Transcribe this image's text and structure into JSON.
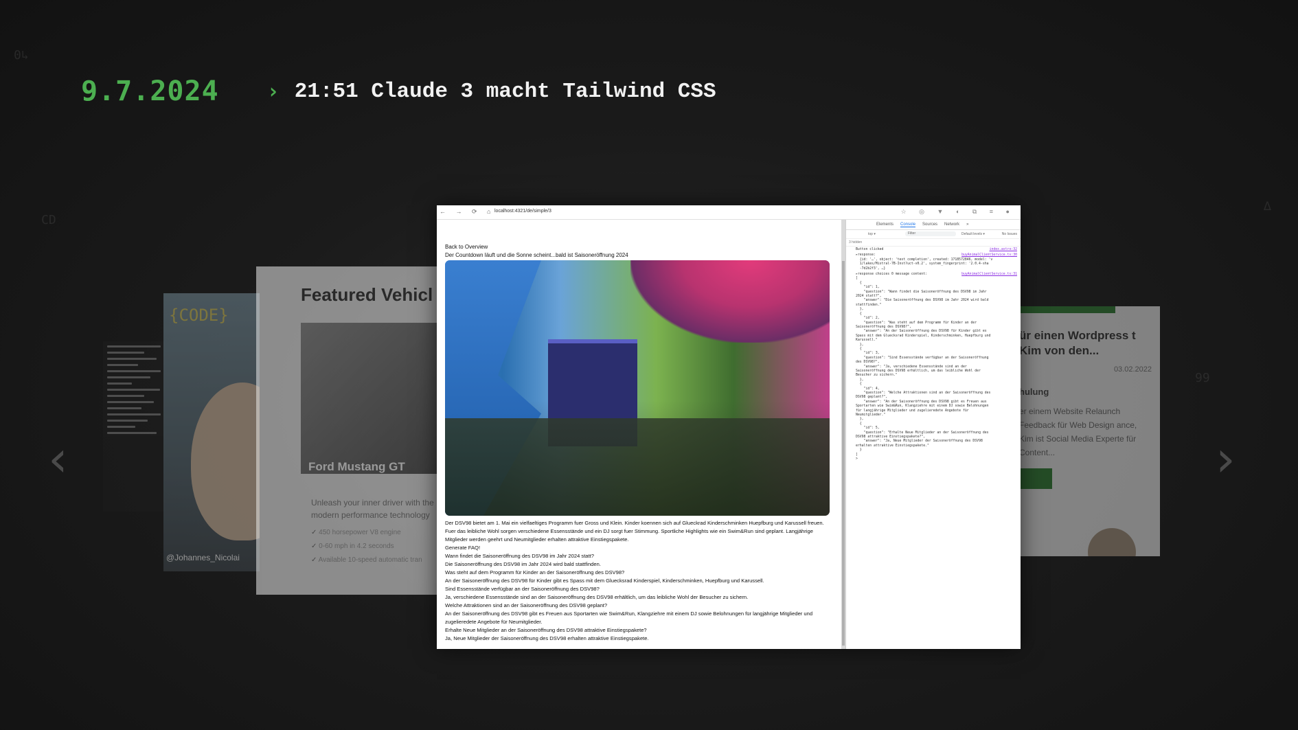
{
  "header": {
    "date": "9.7.2024",
    "chevron": "›",
    "title": "21:51 Claude 3 macht Tailwind CSS"
  },
  "carousel": {
    "prev_arrow": "‹",
    "next_arrow": "›",
    "portrait_card": {
      "logo": "{CODE}",
      "handle": "@Johannes_Nicolai"
    },
    "vehicle_card": {
      "title": "Featured Vehicl",
      "car_name": "Ford Mustang GT",
      "description": "Unleash your inner driver with the modern performance technology",
      "features": [
        "450 horsepower V8 engine",
        "0-60 mph in 4.2 seconds",
        "Available 10-speed automatic tran"
      ]
    },
    "blog_card": {
      "title": "ür einen Wordpress t Kim von den...",
      "date": "03.02.2022",
      "subtitle": "hulung",
      "text": "er einem Website Relaunch Feedback für Web Design ance, Kim ist Social Media Experte für Content..."
    }
  },
  "screenshot": {
    "browser": {
      "nav_icons": "← → ⟳ ⌂",
      "url": "localhost:4321/de/simple/3",
      "extension_icons": "☆ ◎ ▼ ◐ ⧉ ≡ ●"
    },
    "page": {
      "back_link": "Back to Overview",
      "heading": "Der Countdown läuft und die Sonne scheint...bald ist Saisoneröffnung 2024",
      "paragraphs": [
        "Der DSV98 bietet am 1. Mai ein vielfaeltiges Programm fuer Gross und Klein. Kinder koennen sich auf Glueckrad Kinderschminken Huepfburg und Karussell freuen. Fuer das leibliche Wohl sorgen verschiedene Essensstände und ein DJ sorgt fuer Stimmung. Sportliche Highlights wie ein Swim&Run sind geplant. Langjährige Mitglieder werden geehrt und Neumitglieder erhalten attraktive Einstiegspakete.",
        "Generate FAQ!",
        "Wann findet die Saisoneröffnung des DSV98 im Jahr 2024 statt?",
        "Die Saisoneröffnung des DSV98 im Jahr 2024 wird bald stattfinden.",
        "Was steht auf dem Programm für Kinder an der Saisoneröffnung des DSV98?",
        "An der Saisoneröffnung des DSV98 für Kinder gibt es Spass mit dem Gluecksrad Kinderspiel, Kinderschminken, Huepfburg und Karussell.",
        "Sind Essensstände verfügbar an der Saisoneröffnung des DSV98?",
        "Ja, verschiedene Essensstände sind an der Saisoneröffnung des DSV98 erhältlich, um das leibliche Wohl der Besucher zu sichern.",
        "Welche Attraktionen sind an der Saisoneröffnung des DSV98 geplant?",
        "An der Saisoneröffnung des DSV98 gibt es Freuen aus Sportarten wie Swim&Run, Klangziehre mit einem DJ sowie Belohnungen für langjährige Mitglieder und zugelieredete Angebote für Neumitglieder.",
        "Erhalte Neue Mitglieder an der Saisoneröffnung des DSV98 attraktive Einstiegspakete?",
        "Ja, Neue Mitglieder der Saisoneröffnung des DSV98 erhalten attraktive Einstiegspakete."
      ]
    },
    "devtools": {
      "tabs": [
        "Elements",
        "Console",
        "Sources",
        "Network",
        "»"
      ],
      "active_tab": "Console",
      "context": "top ▾",
      "filter_placeholder": "Filter",
      "levels": "Default levels ▾",
      "issues": "No Issues",
      "hidden": "3 hidden",
      "log_lines": [
        {
          "text": "Button clicked",
          "src": "index.astro:32"
        },
        {
          "text": "▸response:",
          "src": "buyAnimalClientService.ts:30"
        },
        {
          "text": "  {id: '…', object: 'text_completion', created: 1718572846, model: 'v\n  1/lakes/Mistral-7B-Instruct-v0.2', system_fingerprint: '2.0.4-sha\n  -7d2b2f3', …}",
          "src": ""
        },
        {
          "text": "▸response choices 0 message content:",
          "src": "buyAnimalClientService.ts:31"
        },
        {
          "text": "[\n  {\n    \"id\": 1,\n    \"question\": \"Wann findet die Saisoneröffnung des DSV98 im Jahr\n2024 statt?\",\n    \"answer\": \"Die Saisoneröffnung des DSV98 im Jahr 2024 wird bald\nstattfinden.\"\n  },\n  {\n    \"id\": 2,\n    \"question\": \"Was steht auf dem Programm für Kinder an der\nSaisoneröffnung des DSV98?\",\n    \"answer\": \"An der Saisoneröffnung des DSV98 für Kinder gibt es\nSpass mit dem Gluecksrad Kinderspiel, Kinderschminken, Huepfburg und\nKarussell.\"\n  },\n  {\n    \"id\": 3,\n    \"question\": \"Sind Essensstände verfügbar an der Saisoneröffnung\ndes DSV98?\",\n    \"answer\": \"Ja, verschiedene Essensstände sind an der\nSaisoneröffnung des DSV98 erhältlich, um das leibliche Wohl der\nBesucher zu sichern.\"\n  },\n  {\n    \"id\": 4,\n    \"question\": \"Welche Attraktionen sind an der Saisoneröffnung des\nDSV98 geplant?\",\n    \"answer\": \"An der Saisoneröffnung des DSV98 gibt es Freuen aus\nSportarten wie Swim&Run, Klangziehre mit einem DJ sowie Belohnungen\nfür langjährige Mitglieder und zugelieredete Angebote für\nNeumitglieder.\"\n  },\n  {\n    \"id\": 5,\n    \"question\": \"Erhalte Neue Mitglieder an der Saisoneröffnung des\nDSV98 attraktive Einstiegspakete?\",\n    \"answer\": \"Ja, Neue Mitglieder der Saisoneröffnung des DSV98\nerhalten attraktive Einstiegspakete.\"\n  }\n]\n>",
          "src": ""
        }
      ]
    }
  },
  "colors": {
    "accent_green": "#4caf50",
    "background": "#1b1b1b",
    "headline": "#f2f2f2"
  }
}
